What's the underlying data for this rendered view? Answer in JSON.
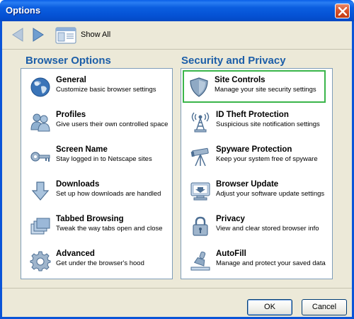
{
  "window": {
    "title": "Options"
  },
  "toolbar": {
    "show_all_label": "Show All"
  },
  "sections": {
    "left_title": "Browser Options",
    "right_title": "Security and Privacy"
  },
  "browser_options": [
    {
      "name": "General",
      "desc": "Customize basic browser settings",
      "icon": "globe-icon"
    },
    {
      "name": "Profiles",
      "desc": "Give users their own controlled space",
      "icon": "users-icon"
    },
    {
      "name": "Screen Name",
      "desc": "Stay logged in to Netscape sites",
      "icon": "key-icon"
    },
    {
      "name": "Downloads",
      "desc": "Set up how downloads are handled",
      "icon": "download-arrow-icon"
    },
    {
      "name": "Tabbed Browsing",
      "desc": "Tweak the way tabs open and close",
      "icon": "tabs-icon"
    },
    {
      "name": "Advanced",
      "desc": "Get under the browser's hood",
      "icon": "gear-icon"
    }
  ],
  "security_options": [
    {
      "name": "Site Controls",
      "desc": "Manage your site security settings",
      "icon": "shield-icon",
      "selected": true
    },
    {
      "name": "ID Theft Protection",
      "desc": "Suspicious site notification settings",
      "icon": "radio-tower-icon"
    },
    {
      "name": "Spyware Protection",
      "desc": "Keep your system free of spyware",
      "icon": "telescope-icon"
    },
    {
      "name": "Browser Update",
      "desc": "Adjust your software update settings",
      "icon": "update-icon"
    },
    {
      "name": "Privacy",
      "desc": "View and clear stored browser info",
      "icon": "padlock-icon"
    },
    {
      "name": "AutoFill",
      "desc": "Manage and protect your saved data",
      "icon": "stamp-icon"
    }
  ],
  "buttons": {
    "ok": "OK",
    "cancel": "Cancel"
  },
  "colors": {
    "section_title": "#1c5ea8",
    "selection_border": "#3ab54a",
    "titlebar": "#0553d6"
  }
}
